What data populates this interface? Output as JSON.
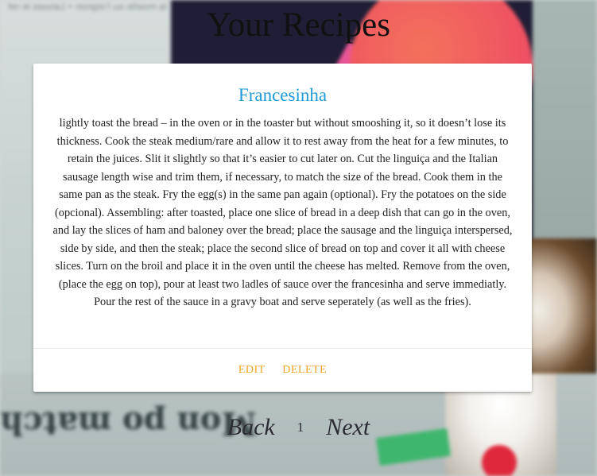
{
  "page": {
    "title": "Your Recipes"
  },
  "recipe": {
    "title": "Francesinha",
    "body": "lightly toast the bread – in the oven or in the toaster but without smooshing it, so it doesn’t lose its thickness. Cook the steak medium/rare and allow it to rest away from the heat for a few minutes, to retain the juices. Slit it slightly so that it’s easier to cut later on. Cut the linguiça and the Italian sausage length wise and trim them, if necessary, to match the size of the bread. Cook them in the same pan as the steak. Fry the egg(s) in the same pan again (optional). Fry the potatoes on the side (opcional). Assembling: after toasted, place one slice of bread in a deep dish that can go in the oven, and lay the slices of ham and baloney over the bread; place the sausage and the linguiça interspersed, side by side, and then the steak; place the second slice of bread on top and cover it all with cheese slices. Turn on the broil and place it in the oven until the cheese has melted. Remove from the oven, (place the egg on top), pour at least two ladles of sauce over the francesinha and serve immediatly. Pour the rest of the sauce in a gravy boat and serve seperately (as well as the fries).",
    "actions": {
      "edit_label": "EDIT",
      "delete_label": "DELETE"
    }
  },
  "pagination": {
    "back_label": "Back",
    "current_page": "1",
    "next_label": "Next"
  },
  "colors": {
    "recipe_title": "#1e9ad6",
    "action_links": "#f1a428",
    "card_background": "#ffffff",
    "page_title": "#111111"
  },
  "background_art": {
    "magazine_text": "Mon po match",
    "magazine_small_text": "la moelle ou l’oignon • Laissez le refroidir • Coupez l’ensemble • Dressez • Ôtez le papier d’alu"
  }
}
